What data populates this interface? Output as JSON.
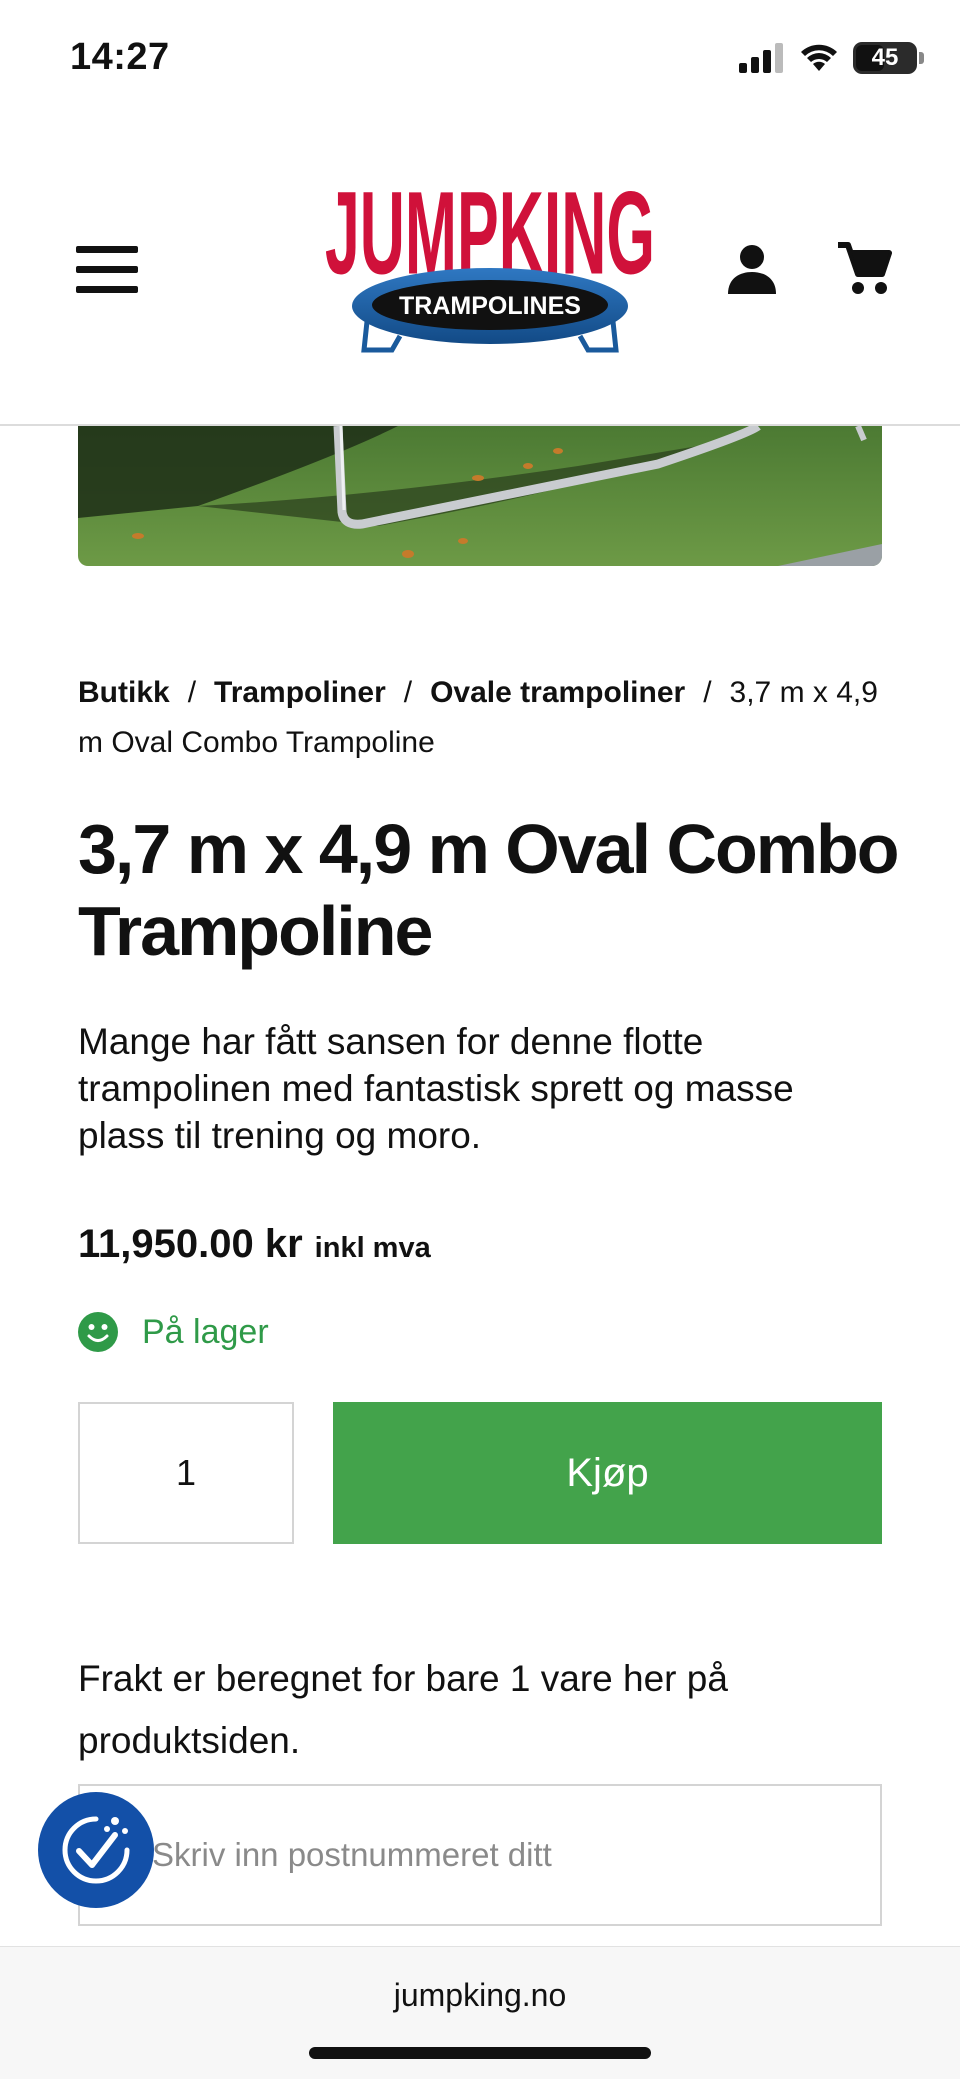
{
  "status_bar": {
    "time": "14:27",
    "battery": "45"
  },
  "header": {
    "logo": {
      "brand": "JUMPKING",
      "tagline": "TRAMPOLINES"
    },
    "icons": [
      "menu-icon",
      "account-icon",
      "cart-icon"
    ]
  },
  "breadcrumb": {
    "items": [
      "Butikk",
      "Trampoliner",
      "Ovale trampoliner"
    ],
    "separator": "/",
    "current": "3,7 m x 4,9 m Oval Combo Trampoline"
  },
  "product": {
    "title": "3,7 m x 4,9 m Oval Combo Trampoline",
    "description": "Mange har fått sansen for denne flotte trampolinen med fantastisk sprett og masse plass til trening og moro.",
    "price": "11,950.00 kr",
    "price_suffix": "inkl mva",
    "stock_status": "På lager",
    "quantity": "1",
    "buy_label": "Kjøp"
  },
  "shipping": {
    "note": "Frakt er beregnet for bare 1 vare her på produktsiden.",
    "postcode_placeholder": "Skriv inn postnummeret ditt"
  },
  "browser": {
    "url": "jumpking.no"
  },
  "colors": {
    "brand_red": "#d0113a",
    "brand_blue": "#1a5a9c",
    "buy_green": "#43a34b",
    "stock_green": "#2f9a48",
    "consent_blue": "#1350a8"
  }
}
